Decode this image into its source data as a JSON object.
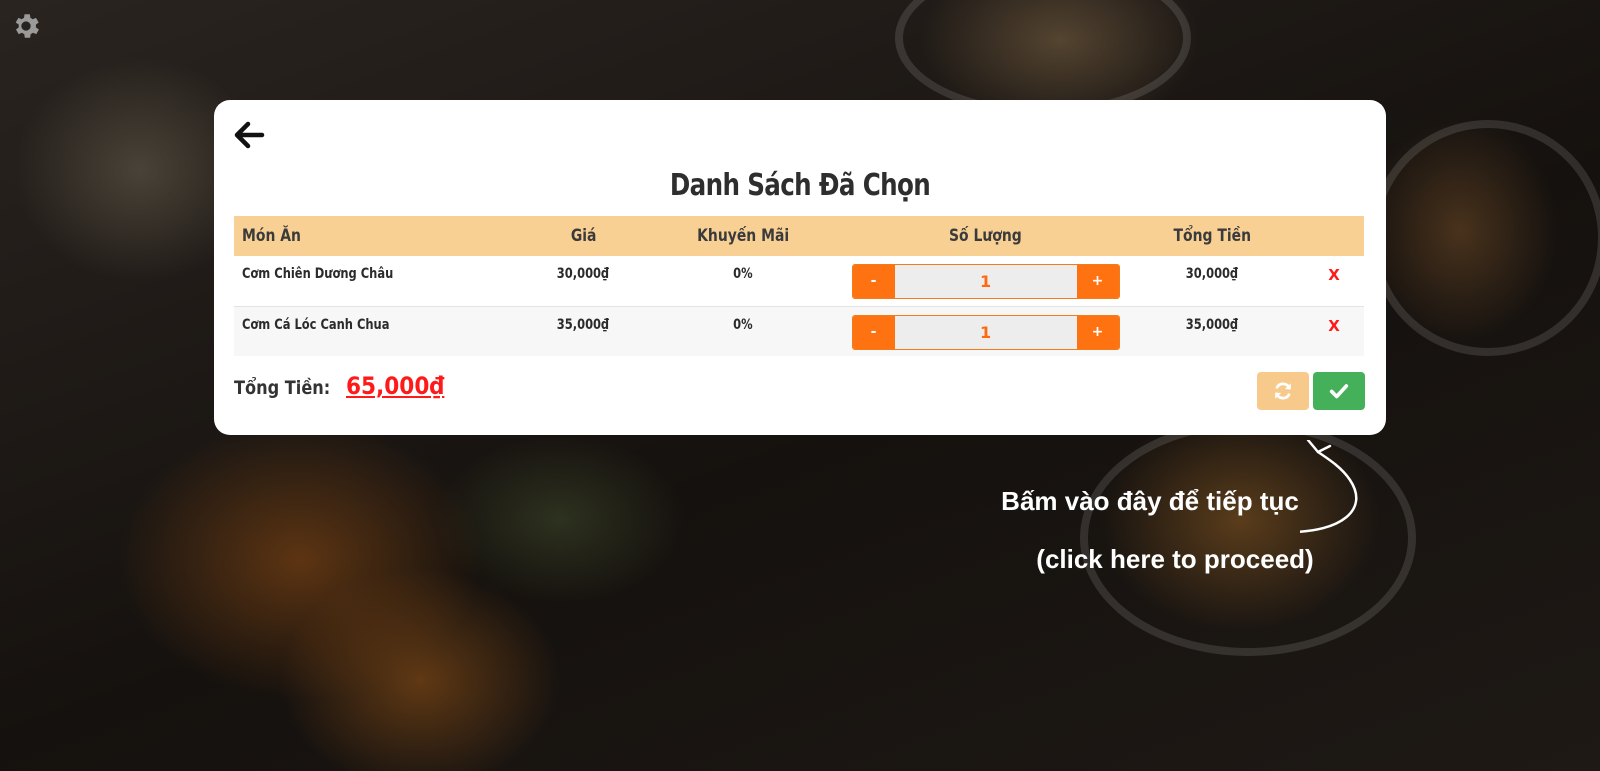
{
  "icons": {
    "settings": "gear-icon",
    "back": "arrow-left-icon",
    "refresh": "refresh-icon",
    "confirm": "checkmark-icon",
    "hint_arrow": "curved-arrow-icon"
  },
  "colors": {
    "header_bg": "#f9d094",
    "qty_button": "#ff7211",
    "qty_value": "#ff6a10",
    "delete": "#ff1a1a",
    "refresh_button": "#f7c98b",
    "confirm_button": "#45b05a",
    "total_amount": "#ff1a1a"
  },
  "modal": {
    "title": "Danh Sách Đã Chọn",
    "table": {
      "headers": {
        "item": "Món Ăn",
        "price": "Giá",
        "discount": "Khuyến Mãi",
        "quantity": "Số Lượng",
        "total": "Tổng Tiền"
      },
      "rows": [
        {
          "name": "Cơm Chiên Dương Châu",
          "price": "30,000₫",
          "discount": "0%",
          "minus": "-",
          "qty": "1",
          "plus": "+",
          "total": "30,000₫",
          "remove": "X"
        },
        {
          "name": "Cơm Cá Lóc Canh Chua",
          "price": "35,000₫",
          "discount": "0%",
          "minus": "-",
          "qty": "1",
          "plus": "+",
          "total": "35,000₫",
          "remove": "X"
        }
      ]
    },
    "total_label": "Tổng Tiền:",
    "total_amount": "65,000₫"
  },
  "hint": {
    "line1": "Bấm vào đây để tiếp tục",
    "line2": "(click here to proceed)"
  }
}
